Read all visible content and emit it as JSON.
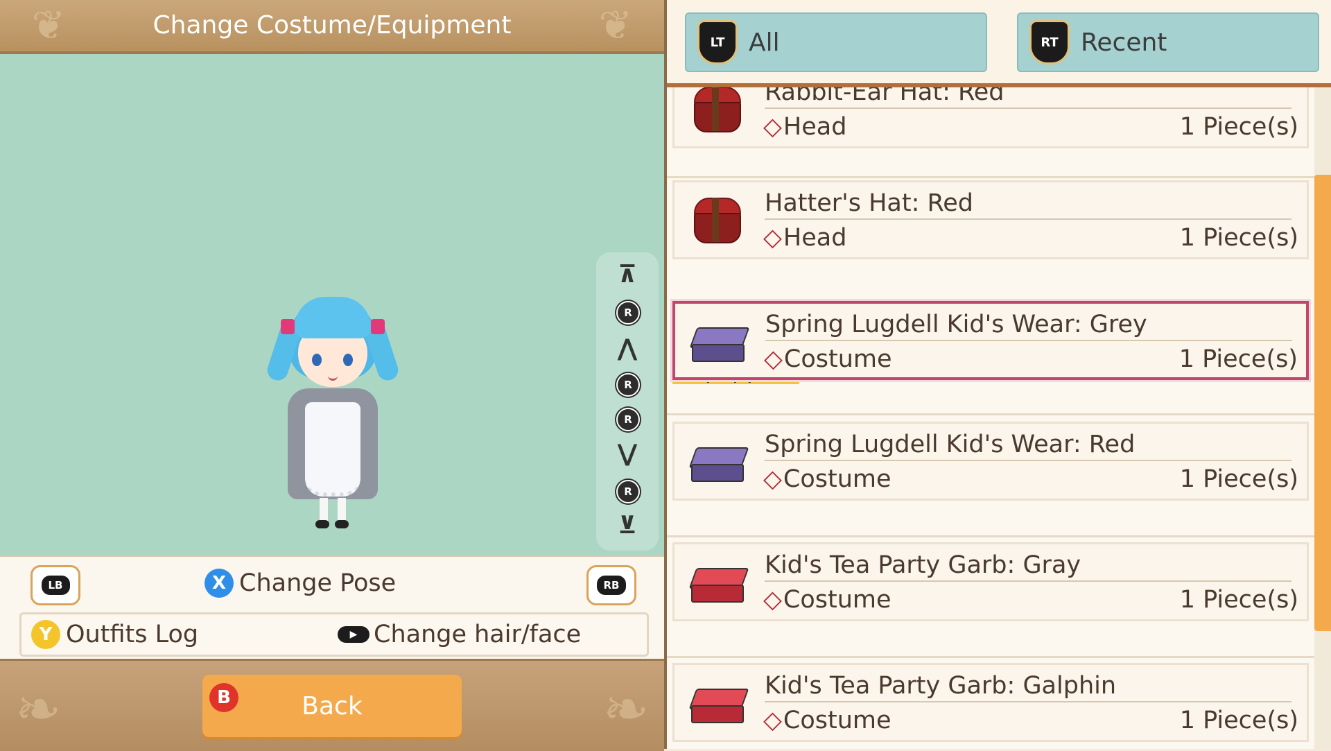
{
  "header": {
    "title": "Change Costume/Equipment"
  },
  "controls": {
    "lb": "LB",
    "rb": "RB",
    "x_button": "X",
    "change_pose": "Change Pose",
    "y_button": "Y",
    "outfits_log": "Outfits Log",
    "change_hair_face": "Change hair/face",
    "b_button": "B",
    "back": "Back"
  },
  "camera": {
    "r": "R",
    "top_arrow": "⊼",
    "up_arrow": "⋀",
    "down_arrow": "⋁",
    "bottom_arrow": "⊻"
  },
  "filters": [
    {
      "badge": "LT",
      "label": "All"
    },
    {
      "badge": "RT",
      "label": "Recent"
    }
  ],
  "equipped_label": "Equipped",
  "items": [
    {
      "name": "Rabbit-Ear Hat: Red",
      "category": "Head",
      "qty": "1 Piece(s)",
      "icon": "hatbox-icon",
      "selected": false
    },
    {
      "name": "Hatter's Hat: Red",
      "category": "Head",
      "qty": "1 Piece(s)",
      "icon": "hatbox-icon",
      "selected": false
    },
    {
      "name": "Spring Lugdell Kid's Wear: Grey",
      "category": "Costume",
      "qty": "1 Piece(s)",
      "icon": "suitcase-purple-icon",
      "selected": true
    },
    {
      "name": "Spring Lugdell Kid's Wear: Red",
      "category": "Costume",
      "qty": "1 Piece(s)",
      "icon": "suitcase-purple-icon",
      "selected": false
    },
    {
      "name": "Kid's Tea Party Garb: Gray",
      "category": "Costume",
      "qty": "1 Piece(s)",
      "icon": "suitcase-red-icon",
      "selected": false
    },
    {
      "name": "Kid's Tea Party Garb: Galphin",
      "category": "Costume",
      "qty": "1 Piece(s)",
      "icon": "suitcase-red-icon",
      "selected": false
    }
  ],
  "colors": {
    "accent_orange": "#f4aa4c",
    "selected_border": "#c0476a",
    "equipped_tag": "#f4c53b",
    "tab_bg": "#a6d1d1",
    "viewer_bg": "#acd6c4"
  }
}
